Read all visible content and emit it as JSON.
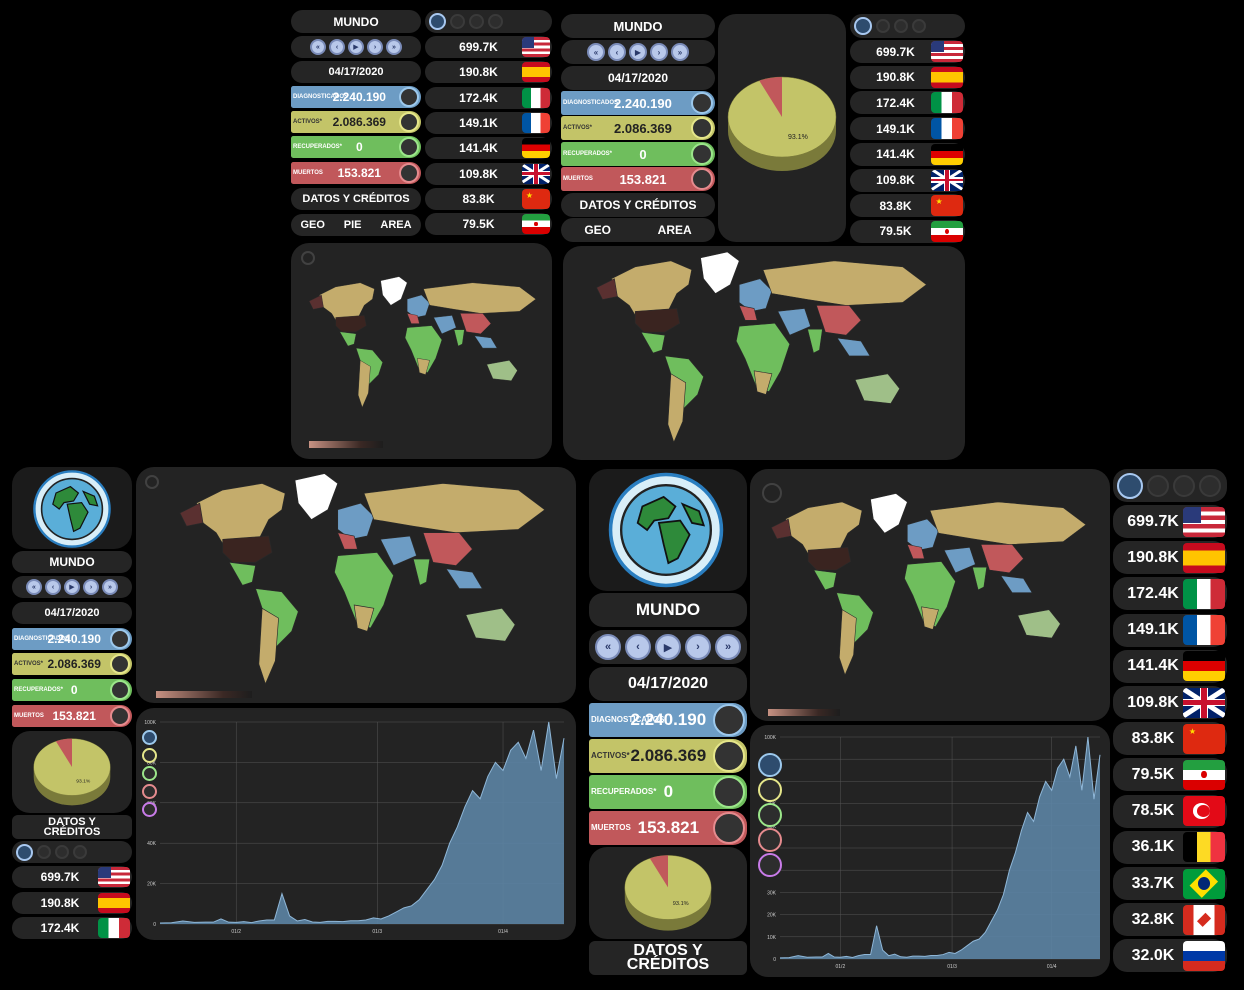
{
  "region": "MUNDO",
  "date": "04/17/2020",
  "stats": {
    "diag_label": "DIAGNOSTICADOS",
    "diag_value": "2.240.190",
    "act_label": "ACTIVOS*",
    "act_value": "2.086.369",
    "rec_label": "RECUPERADOS*",
    "rec_value": "0",
    "mue_label": "MUERTOS",
    "mue_value": "153.821"
  },
  "credits": "DATOS Y CRÉDITOS",
  "credits_v1": "DATOS Y",
  "credits_v2": "CRÉDITOS",
  "views": {
    "geo": "GEO",
    "pie": "PIE",
    "area": "AREA"
  },
  "pie_percent": "93.1%",
  "countries": [
    {
      "value": "699.7K",
      "flag": "us"
    },
    {
      "value": "190.8K",
      "flag": "es"
    },
    {
      "value": "172.4K",
      "flag": "it"
    },
    {
      "value": "149.1K",
      "flag": "fr"
    },
    {
      "value": "141.4K",
      "flag": "de"
    },
    {
      "value": "109.8K",
      "flag": "gb"
    },
    {
      "value": "83.8K",
      "flag": "cn"
    },
    {
      "value": "79.5K",
      "flag": "ir"
    },
    {
      "value": "78.5K",
      "flag": "tr"
    },
    {
      "value": "36.1K",
      "flag": "be"
    },
    {
      "value": "33.7K",
      "flag": "br"
    },
    {
      "value": "32.8K",
      "flag": "ca"
    },
    {
      "value": "32.0K",
      "flag": "ru"
    }
  ],
  "chart_data": {
    "type": "area",
    "x_ticks": [
      "01/2",
      "01/3",
      "01/4"
    ],
    "y_ticks": [
      "0",
      "20K",
      "40K",
      "60K",
      "80K",
      "100K"
    ],
    "y_ticks_long": [
      "0",
      "10K",
      "20K",
      "30K",
      "40K",
      "50K",
      "60K",
      "70K",
      "80K",
      "90K",
      "100K"
    ],
    "ylim": [
      0,
      100000
    ],
    "x_days": [
      0,
      3,
      6,
      9,
      12,
      14,
      16,
      18,
      20,
      22,
      24,
      26,
      28,
      30,
      32,
      34,
      36,
      38,
      40,
      42,
      44,
      46,
      48,
      50,
      52,
      54,
      56,
      58,
      60,
      62,
      64,
      66,
      68,
      70,
      72,
      74,
      76,
      78,
      80,
      82,
      84,
      86,
      88,
      90,
      92,
      94,
      96,
      98,
      100,
      102,
      104,
      106
    ],
    "values": [
      500,
      600,
      1500,
      800,
      900,
      900,
      2500,
      900,
      800,
      1200,
      700,
      1500,
      2000,
      2000,
      15000,
      4000,
      1500,
      2200,
      1000,
      800,
      1300,
      1300,
      1200,
      1600,
      1600,
      2000,
      3000,
      2500,
      4000,
      6000,
      8000,
      9000,
      12000,
      17000,
      22000,
      29000,
      40000,
      48000,
      58000,
      66000,
      62000,
      73000,
      80000,
      76000,
      86000,
      90000,
      82000,
      96000,
      76000,
      100000,
      72000,
      92000
    ],
    "area_color": "#5c84a4",
    "line_color": "#8fb7d8"
  },
  "colors": {
    "bg": "#000000",
    "panel": "#232323",
    "pill": "#252525",
    "diag": "#6d9cc4",
    "act": "#c3c468",
    "rec": "#6fbe5d",
    "mue": "#c1585b"
  }
}
